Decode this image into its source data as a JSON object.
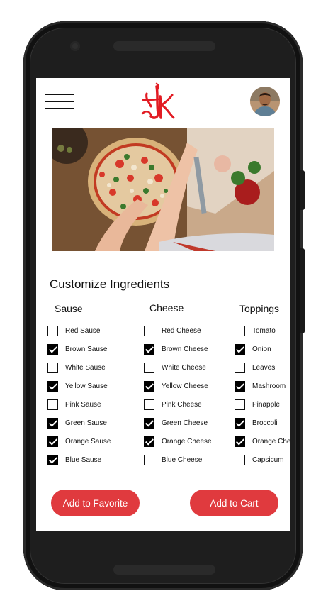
{
  "header": {
    "menu_icon": "hamburger-menu-icon",
    "logo_text": "HK",
    "brand_color": "#e21b23",
    "avatar_icon": "user-avatar"
  },
  "hero": {
    "image_subject": "pizza-preparation-photo"
  },
  "section": {
    "title": "Customize Ingredients"
  },
  "columns": {
    "sause": {
      "title": "Sause",
      "items": [
        {
          "label": "Red Sause",
          "checked": false
        },
        {
          "label": "Brown Sause",
          "checked": true
        },
        {
          "label": "White Sause",
          "checked": false
        },
        {
          "label": "Yellow Sause",
          "checked": true
        },
        {
          "label": "Pink Sause",
          "checked": false
        },
        {
          "label": "Green Sause",
          "checked": true
        },
        {
          "label": "Orange Sause",
          "checked": true
        },
        {
          "label": "Blue Sause",
          "checked": true
        }
      ]
    },
    "cheese": {
      "title": "Cheese",
      "items": [
        {
          "label": "Red Cheese",
          "checked": false
        },
        {
          "label": "Brown Cheese",
          "checked": true
        },
        {
          "label": "White Cheese",
          "checked": false
        },
        {
          "label": "Yellow Cheese",
          "checked": true
        },
        {
          "label": "Pink Cheese",
          "checked": false
        },
        {
          "label": "Green Cheese",
          "checked": true
        },
        {
          "label": "Orange Cheese",
          "checked": true
        },
        {
          "label": "Blue Cheese",
          "checked": false
        }
      ]
    },
    "toppings": {
      "title": "Toppings",
      "items": [
        {
          "label": "Tomato",
          "checked": false
        },
        {
          "label": "Onion",
          "checked": true
        },
        {
          "label": "Leaves",
          "checked": false
        },
        {
          "label": "Mashroom",
          "checked": true
        },
        {
          "label": "Pinapple",
          "checked": false
        },
        {
          "label": "Broccoli",
          "checked": true
        },
        {
          "label": "Orange Chee",
          "checked": true
        },
        {
          "label": "Capsicum",
          "checked": false
        }
      ]
    }
  },
  "actions": {
    "favorite_label": "Add to Favorite",
    "cart_label": "Add to Cart",
    "button_color": "#e03a3e"
  }
}
